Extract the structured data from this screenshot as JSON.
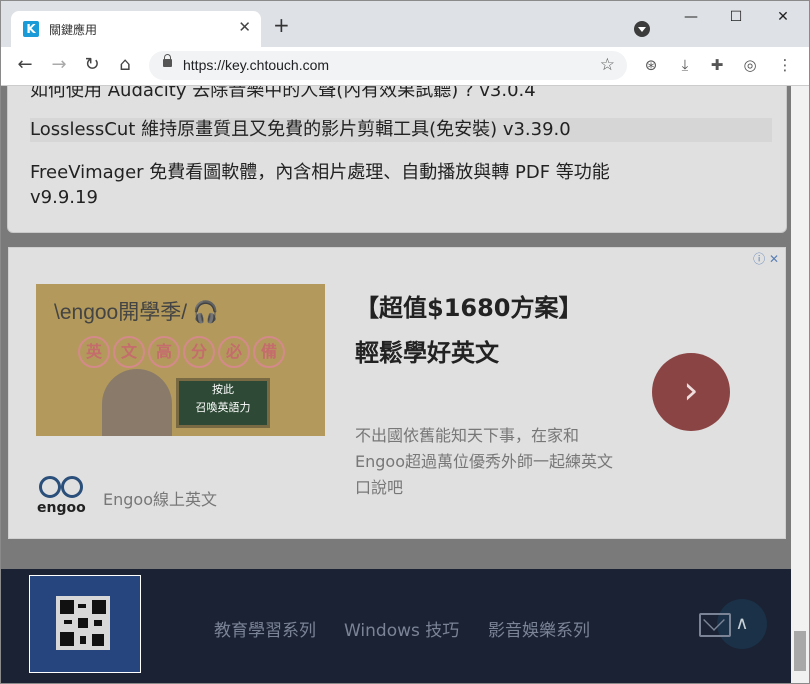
{
  "browser": {
    "tab_title": "關鍵應用",
    "favicon_letter": "K",
    "new_tab": "+",
    "url": "https://key.chtouch.com",
    "window_buttons": {
      "minimize": "—",
      "maximize": "☐",
      "close": "✕"
    }
  },
  "page": {
    "posts": [
      "如何使用 Audacity 去除音樂中的人聲(內有效果試聽) ? v3.0.4",
      "LosslessCut 維持原畫質且又免費的影片剪輯工具(免安裝) v3.39.0",
      "FreeVimager 免費看圖軟體，內含相片處理、自動播放與轉 PDF 等功能",
      "v9.9.19"
    ],
    "ad": {
      "info": "ⓘ ✕",
      "image_brand": "\\engoo開學季/ 🎧",
      "image_chips": [
        "英",
        "文",
        "高",
        "分",
        "必",
        "備"
      ],
      "image_board": [
        "按此",
        "召喚英語力"
      ],
      "title": "【超值$1680方案】輕鬆學好英文",
      "description": "不出國依舊能知天下事，在家和Engoo超過萬位優秀外師一起練英文口說吧",
      "logo_word": "engoo",
      "advertiser": "Engoo線上英文",
      "arrow": "›"
    },
    "footer": {
      "links": [
        "教育學習系列",
        "Windows 技巧",
        "影音娛樂系列"
      ],
      "to_top": "∧"
    }
  },
  "colors": {
    "tabbar": "#dee1e6",
    "overlay_page": "#7a7a7a",
    "footer": "#1a2233",
    "qr_box": "#26447d"
  }
}
